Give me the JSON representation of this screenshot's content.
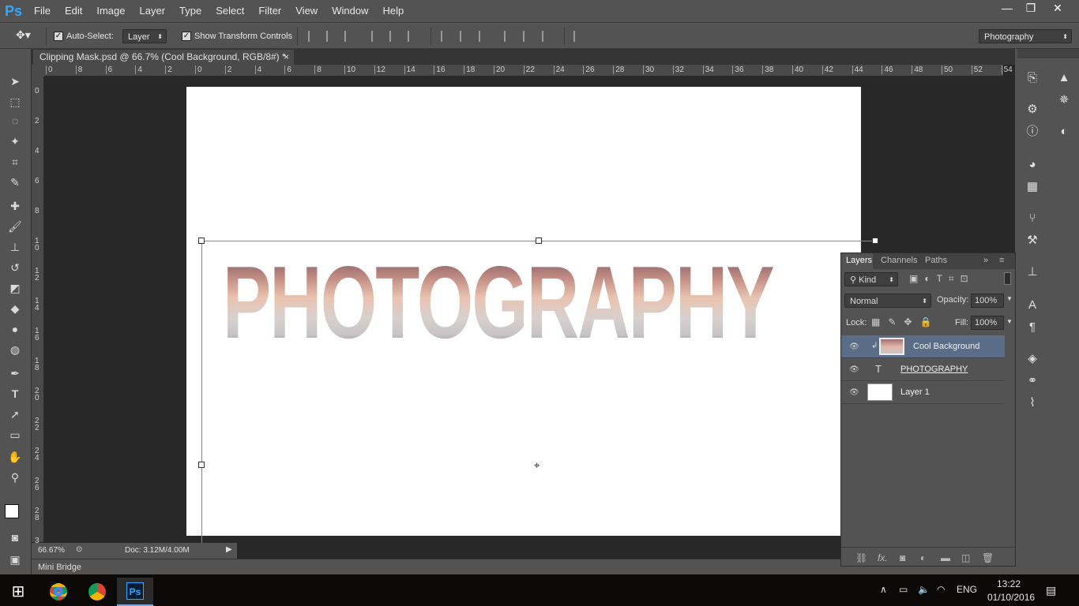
{
  "app": {
    "logo": "Ps"
  },
  "menu": [
    "File",
    "Edit",
    "Image",
    "Layer",
    "Type",
    "Select",
    "Filter",
    "View",
    "Window",
    "Help"
  ],
  "window_controls": {
    "minimize": "—",
    "restore": "❐",
    "close": "✕"
  },
  "options": {
    "auto_select_label": "Auto-Select:",
    "auto_select_target": "Layer",
    "show_transform_label": "Show Transform Controls",
    "workspace": "Photography"
  },
  "document_tab": {
    "title": "Clipping Mask.psd @ 66.7% (Cool Background, RGB/8#) *",
    "close": "×"
  },
  "hruler_labels": [
    "0",
    "8",
    "6",
    "4",
    "2",
    "0",
    "2",
    "4",
    "6",
    "8",
    "10",
    "12",
    "14",
    "16",
    "18",
    "20",
    "22",
    "24",
    "26",
    "28",
    "30",
    "32",
    "34",
    "36",
    "38",
    "40",
    "42",
    "44",
    "46",
    "48",
    "50",
    "52",
    "54"
  ],
  "vruler_labels": [
    "0",
    "2",
    "4",
    "6",
    "8",
    "1 0",
    "1 2",
    "1 4",
    "1 6",
    "1 8",
    "2 0",
    "2 2",
    "2 4",
    "2 6",
    "2 8",
    "3"
  ],
  "canvas_text": "PHOTOGRAPHY",
  "status": {
    "zoom": "66.67%",
    "doc": "Doc: 3.12M/4.00M"
  },
  "mini_bridge": "Mini Bridge",
  "layers_panel": {
    "tabs": [
      "Layers",
      "Channels",
      "Paths"
    ],
    "filter_kind": "Kind",
    "blend_mode": "Normal",
    "opacity_label": "Opacity:",
    "opacity_value": "100%",
    "lock_label": "Lock:",
    "fill_label": "Fill:",
    "fill_value": "100%",
    "layers": [
      {
        "name": "Cool Background",
        "selected": true
      },
      {
        "name": "PHOTOGRAPHY",
        "selected": false
      },
      {
        "name": "Layer 1",
        "selected": false
      }
    ],
    "footer_icons": [
      "link-icon",
      "fx-icon",
      "mask-icon",
      "adjustment-icon",
      "folder-icon",
      "new-layer-icon",
      "trash-icon"
    ]
  },
  "taskbar": {
    "time": "13:22",
    "date": "01/10/2016",
    "language": "ENG",
    "ps_label": "Ps"
  },
  "colors": {
    "accent": "#31a8ff",
    "panel": "#535353",
    "canvas_bg": "#282828",
    "selected_layer": "#5b6d86"
  }
}
